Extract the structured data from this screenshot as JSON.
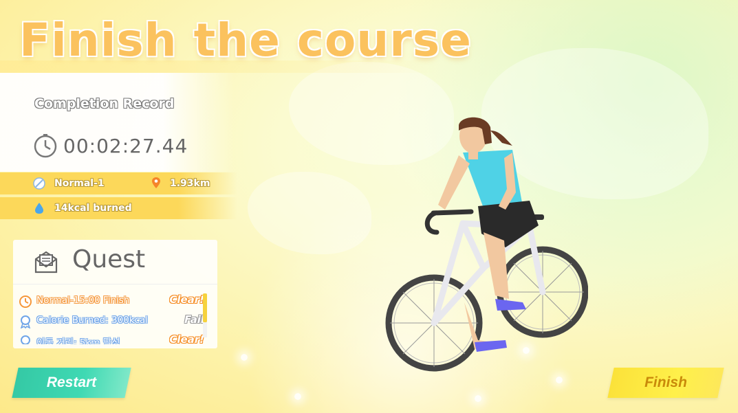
{
  "title": "Finish the course",
  "record": {
    "label": "Completion Record",
    "time": "00:02:27.44",
    "course": "Normal-1",
    "distance": "1.93km",
    "calories": "14kcal burned"
  },
  "quest": {
    "title": "Quest",
    "items": [
      {
        "text": "Normal-15:00 Finish",
        "status": "Clear!",
        "icon": "clock-icon"
      },
      {
        "text": "Calorie Burned: 300kcal",
        "status": "Fail",
        "icon": "medal-icon"
      },
      {
        "text": "이동 거리: 5km 달성",
        "status": "Clear!",
        "icon": "medal-icon"
      }
    ]
  },
  "buttons": {
    "restart": "Restart",
    "finish": "Finish"
  },
  "colors": {
    "title": "#fbc25e",
    "info_band": "#fcd85a",
    "restart": "#3fd9b3",
    "finish": "#fbe23a",
    "clear": "#f58a1e",
    "fail": "#999999"
  }
}
